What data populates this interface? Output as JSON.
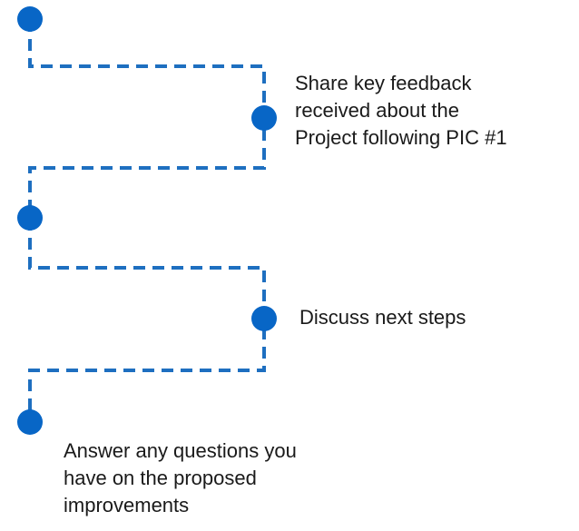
{
  "colors": {
    "path": "#1E6FC0",
    "node": "#0866C6",
    "text": "#1a1a1a"
  },
  "steps": [
    {
      "text": ""
    },
    {
      "text": "Share key feedback\nreceived about the\nProject following PIC #1"
    },
    {
      "text": ""
    },
    {
      "text": "Discuss next steps"
    },
    {
      "text": "Answer any questions you\nhave on the proposed\nimprovements"
    }
  ]
}
